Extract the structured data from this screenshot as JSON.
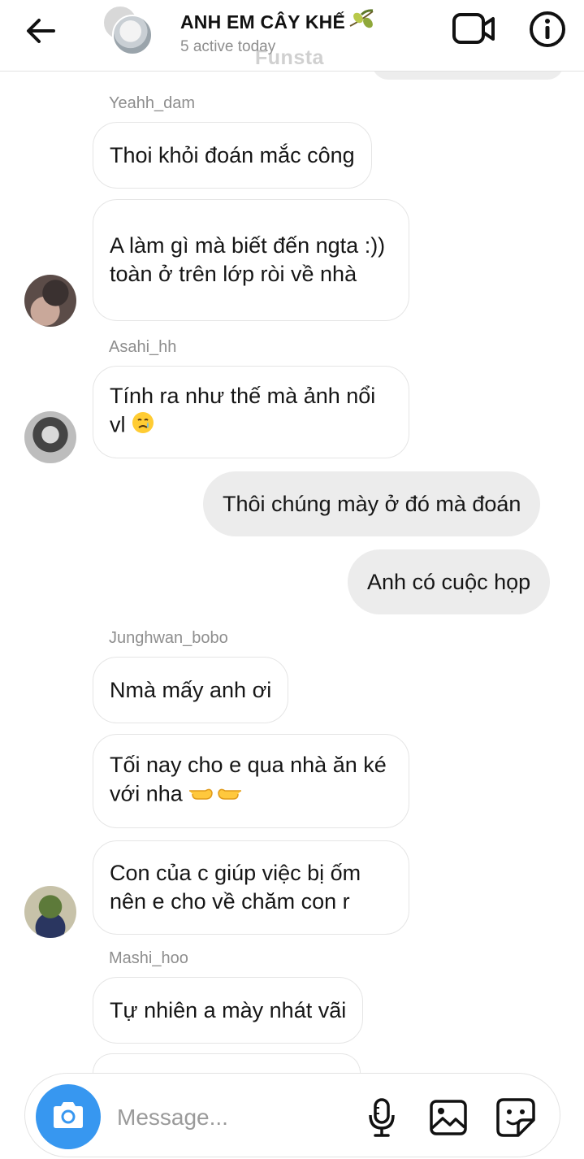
{
  "header": {
    "title": "ANH EM CÂY KHẾ",
    "subtitle": "5 active today",
    "watermark": "Funsta",
    "icons": {
      "back": "arrow-left-icon",
      "title_emoji": "olive-emoji",
      "video": "video-camera-icon",
      "info": "info-icon"
    }
  },
  "messages": {
    "m1": {
      "sender": "Yeahh_dam",
      "text": "Thoi khỏi đoán mắc công"
    },
    "m2": {
      "text": "A làm gì mà biết đến ngta :)) toàn ở trên lớp ròi về nhà"
    },
    "m3": {
      "sender": "Asahi_hh",
      "text": "Tính ra như thế mà ảnh nổi vl",
      "emoji": "face-holding-back-tears"
    },
    "m4": {
      "text": "Thôi chúng mày ở đó mà đoán"
    },
    "m5": {
      "text": "Anh có cuộc họp"
    },
    "m6": {
      "sender": "Junghwan_bobo",
      "text": "Nmà mấy anh ơi"
    },
    "m7": {
      "text": "Tối nay cho e qua nhà ăn ké với nha",
      "emoji": "pointing-fingers"
    },
    "m8": {
      "text": "Con của c giúp việc bị ốm nên e cho về chăm con r"
    },
    "m9": {
      "sender": "Mashi_hoo",
      "text": "Tự nhiên a mày nhát vãi"
    }
  },
  "composer": {
    "placeholder": "Message...",
    "icons": {
      "camera": "camera-icon",
      "mic": "microphone-icon",
      "gallery": "image-gallery-icon",
      "sticker": "sticker-icon"
    }
  },
  "colors": {
    "accent": "#3797f0",
    "outgoing_bubble": "#ececec",
    "incoming_border": "#e5e5e5",
    "secondary_text": "#8e8e8e"
  }
}
